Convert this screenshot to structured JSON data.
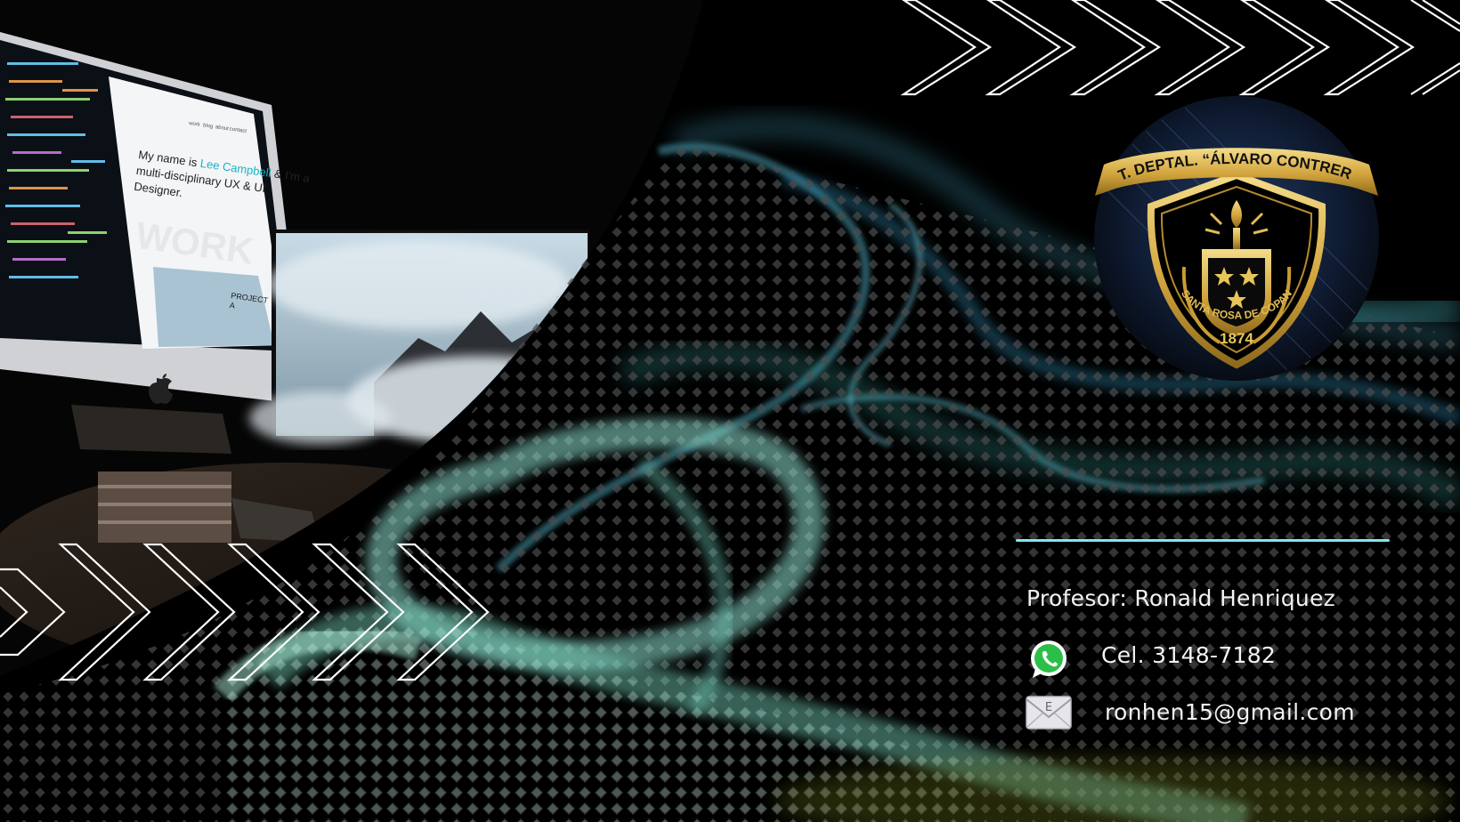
{
  "colors": {
    "background": "#000000",
    "accent_line": "#7fe6ef",
    "smoke_teal": "#3fa7a6",
    "smoke_blue": "#2f82a6",
    "emblem_gold": "#d7b24a",
    "chevron_stroke": "#ffffff",
    "text": "#f2f2f2"
  },
  "screen": {
    "headline_prefix": "My name is",
    "headline_name": "Lee Campbell",
    "headline_rest_1": "& I'm a",
    "headline_rest_2": "multi-disciplinary UX & UI",
    "headline_rest_3": "Designer.",
    "watermark": "WORK",
    "project_label_1": "PROJECT",
    "project_label_2": "A",
    "nav": [
      "work",
      "blog",
      "about",
      "contact"
    ]
  },
  "emblem": {
    "banner_text": "INST. DEPTAL. “ÁLVARO CONTRERAS”",
    "ring_text": "SANTA ROSA DE COPAN",
    "year": "1874"
  },
  "contact": {
    "teacher": "Profesor: Ronald Henriquez",
    "phone": "Cel. 3148-7182",
    "email": "ronhen15@gmail.com",
    "phone_icon": "whatsapp-icon",
    "email_icon": "envelope-icon",
    "envelope_letter": "E"
  }
}
